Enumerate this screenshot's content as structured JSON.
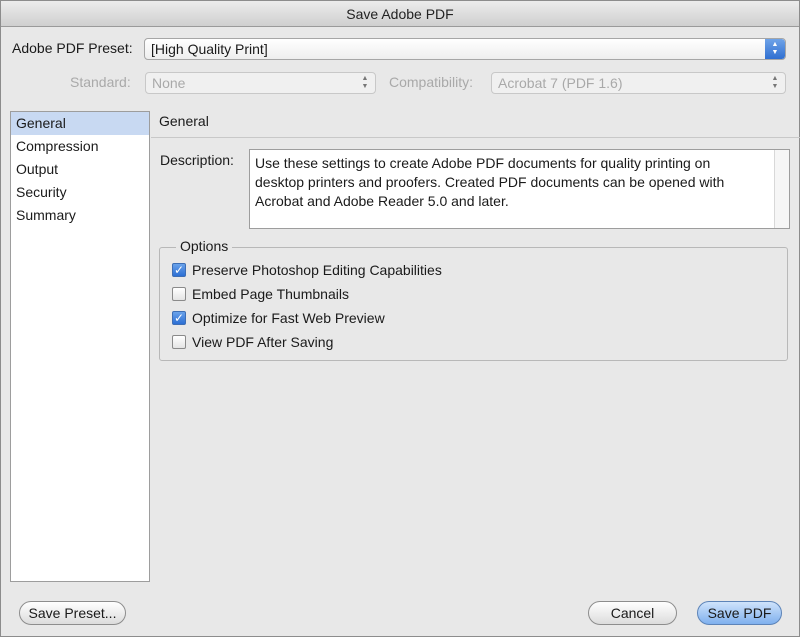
{
  "window": {
    "title": "Save Adobe PDF"
  },
  "preset": {
    "label": "Adobe PDF Preset:",
    "value": "[High Quality Print]"
  },
  "standard": {
    "label": "Standard:",
    "value": "None"
  },
  "compatibility": {
    "label": "Compatibility:",
    "value": "Acrobat 7 (PDF 1.6)"
  },
  "sidebar": {
    "items": [
      {
        "label": "General",
        "selected": true
      },
      {
        "label": "Compression",
        "selected": false
      },
      {
        "label": "Output",
        "selected": false
      },
      {
        "label": "Security",
        "selected": false
      },
      {
        "label": "Summary",
        "selected": false
      }
    ]
  },
  "main": {
    "heading": "General",
    "description_label": "Description:",
    "description_lines": [
      "Use these settings to create Adobe PDF documents for quality printing on",
      "desktop printers and proofers.  Created PDF documents can be opened with",
      "Acrobat and Adobe Reader 5.0 and later."
    ],
    "options": {
      "title": "Options",
      "items": [
        {
          "label": "Preserve Photoshop Editing Capabilities",
          "checked": true
        },
        {
          "label": "Embed Page Thumbnails",
          "checked": false
        },
        {
          "label": "Optimize for Fast Web Preview",
          "checked": true
        },
        {
          "label": "View PDF After Saving",
          "checked": false
        }
      ]
    }
  },
  "buttons": {
    "save_preset": "Save Preset...",
    "cancel": "Cancel",
    "save_pdf": "Save PDF"
  },
  "colors": {
    "selection": "#c8d9f2",
    "accent": "#2c6fd4"
  }
}
